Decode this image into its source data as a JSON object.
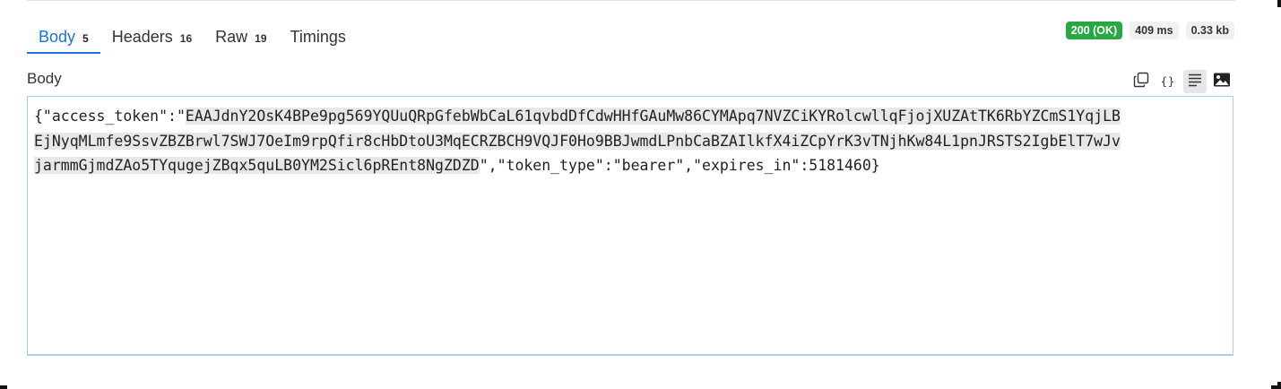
{
  "tabs": [
    {
      "label": "Body",
      "count": "5",
      "active": true
    },
    {
      "label": "Headers",
      "count": "16",
      "active": false
    },
    {
      "label": "Raw",
      "count": "19",
      "active": false
    },
    {
      "label": "Timings",
      "count": "",
      "active": false
    }
  ],
  "status": {
    "code": "200 (OK)",
    "time": "409 ms",
    "size": "0.33 kb"
  },
  "body_section": {
    "label": "Body"
  },
  "toolbar": {
    "icons": [
      "copy-icon",
      "braces-icon",
      "wrap-lines-icon",
      "image-icon"
    ],
    "braces_glyph": "{}"
  },
  "response": {
    "line1_prefix": "{\"access_token\":\"",
    "line1_token": "EAAJdnY2OsK4BPe9pg569YQUuQRpGfebWbCaL61qvbdDfCdwHHfGAuMw86CYMApq7NVZCiKYRolcwllqFjojXUZAtTK6RbYZCmS1YqjLB",
    "line2_token": "EjNyqMLmfe9SsvZBZBrwl7SWJ7OeIm9rpQfir8cHbDtoU3MqECRZBCH9VQJF0Ho9BBJwmdLPnbCaBZAIlkfX4iZCpYrK3vTNjhKw84L1pnJRSTS2IgbElT7wJv",
    "line3_token": "jarmmGjmdZAo5TYqugejZBqx5quLB0YM2Sicl6pREnt8NgZDZD",
    "line3_suffix": "\",\"token_type\":\"bearer\",\"expires_in\":5181460}"
  },
  "colors": {
    "accent": "#1a73d9",
    "ok_badge": "#27a845",
    "box_border": "#a9cdf0",
    "selection": "#e8e8e8"
  }
}
